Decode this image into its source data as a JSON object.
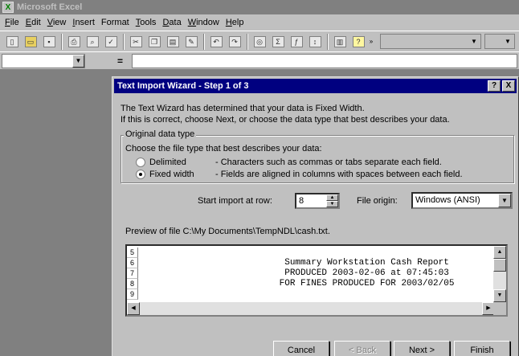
{
  "app": {
    "title": "Microsoft Excel",
    "icon_label": "X"
  },
  "menu": {
    "items": [
      {
        "first": "F",
        "rest": "ile"
      },
      {
        "first": "E",
        "rest": "dit"
      },
      {
        "first": "V",
        "rest": "iew"
      },
      {
        "first": "I",
        "rest": "nsert"
      },
      {
        "first": "",
        "rest": "Format"
      },
      {
        "first": "T",
        "rest": "ools"
      },
      {
        "first": "D",
        "rest": "ata"
      },
      {
        "first": "W",
        "rest": "indow"
      },
      {
        "first": "H",
        "rest": "elp"
      }
    ]
  },
  "toolbar": {
    "icons": [
      "new-icon",
      "open-icon",
      "save-icon",
      "print-icon",
      "print-preview-icon",
      "spelling-icon",
      "cut-icon",
      "copy-icon",
      "paste-icon",
      "format-painter-icon",
      "undo-icon",
      "redo-icon",
      "hyperlink-icon",
      "autosum-icon",
      "function-icon",
      "sort-icon",
      "chart-wizard-icon",
      "help-icon"
    ]
  },
  "formula_bar": {
    "equals_label": "="
  },
  "dialog": {
    "title": "Text Import Wizard - Step 1 of 3",
    "help_button": "?",
    "close_button": "X",
    "intro_line1": "The Text Wizard has determined that your data is Fixed Width.",
    "intro_line2": "If this is correct, choose Next, or choose the data type that best describes your data.",
    "group_label": "Original data type",
    "group_description": "Choose the file type that best describes your data:",
    "options": [
      {
        "label": "Delimited",
        "description": "- Characters such as commas or tabs separate each field.",
        "selected": false
      },
      {
        "label": "Fixed width",
        "description": "- Fields are aligned in columns with spaces between each field.",
        "selected": true
      }
    ],
    "start_row_label": "Start import at row:",
    "start_row_value": "8",
    "file_origin_label": "File origin:",
    "file_origin_value": "Windows (ANSI)",
    "preview_label": "Preview of file C:\\My Documents\\TempNDL\\cash.txt.",
    "preview_lines": [
      {
        "num": "5",
        "text": ""
      },
      {
        "num": "6",
        "text": "                           Summary Workstation Cash Report"
      },
      {
        "num": "7",
        "text": "                           PRODUCED 2003-02-06 at 07:45:03"
      },
      {
        "num": "8",
        "text": "                          FOR FINES PRODUCED FOR 2003/02/05"
      },
      {
        "num": "9",
        "text": ""
      }
    ],
    "buttons": {
      "cancel": "Cancel",
      "back": "< Back",
      "next": "Next >",
      "finish": "Finish"
    }
  }
}
